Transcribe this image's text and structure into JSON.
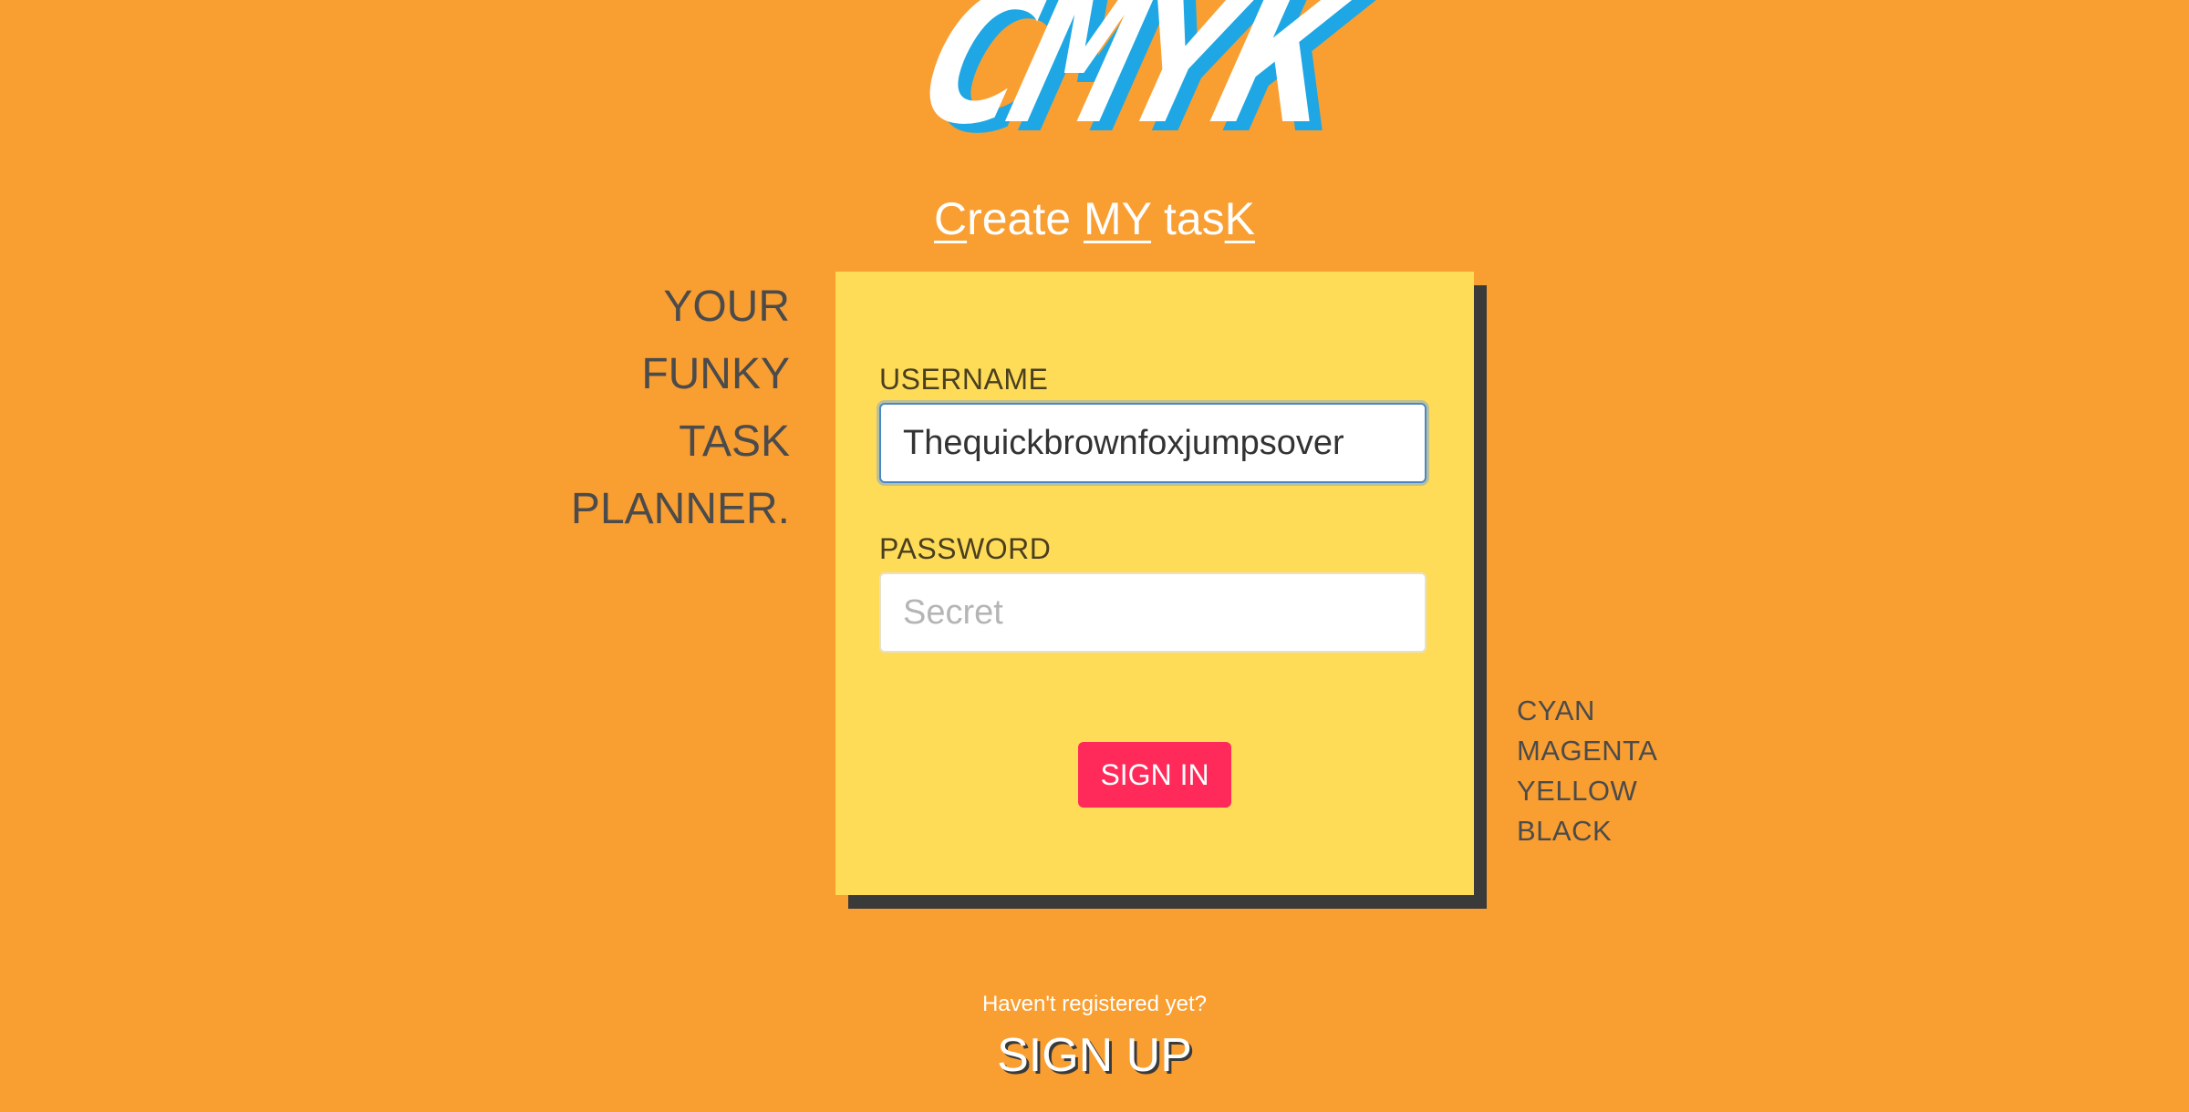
{
  "logo": {
    "text": "CMYK"
  },
  "tagline": {
    "parts": [
      {
        "text": "C",
        "underline": true
      },
      {
        "text": "reate ",
        "underline": false
      },
      {
        "text": "MY",
        "underline": true
      },
      {
        "text": " tas",
        "underline": false
      },
      {
        "text": "K",
        "underline": true
      }
    ]
  },
  "slogan": {
    "lines": [
      "YOUR",
      "FUNKY",
      "TASK",
      "PLANNER."
    ]
  },
  "form": {
    "username_label": "USERNAME",
    "username_value": "Thequickbrownfoxjumpsover",
    "password_label": "PASSWORD",
    "password_placeholder": "Secret",
    "password_value": "",
    "signin_label": "SIGN IN"
  },
  "colors_list": [
    "CYAN",
    "MAGENTA",
    "YELLOW",
    "BLACK"
  ],
  "footer": {
    "prompt": "Haven't registered yet?",
    "signup_label": "SIGN UP"
  },
  "theme": {
    "background": "#f99e31",
    "card": "#ffdc58",
    "card_shadow": "#3a3a3a",
    "accent_button": "#ff2a5a",
    "logo_shadow": "#1ea7e4",
    "text_dark": "#4b4b4b"
  }
}
